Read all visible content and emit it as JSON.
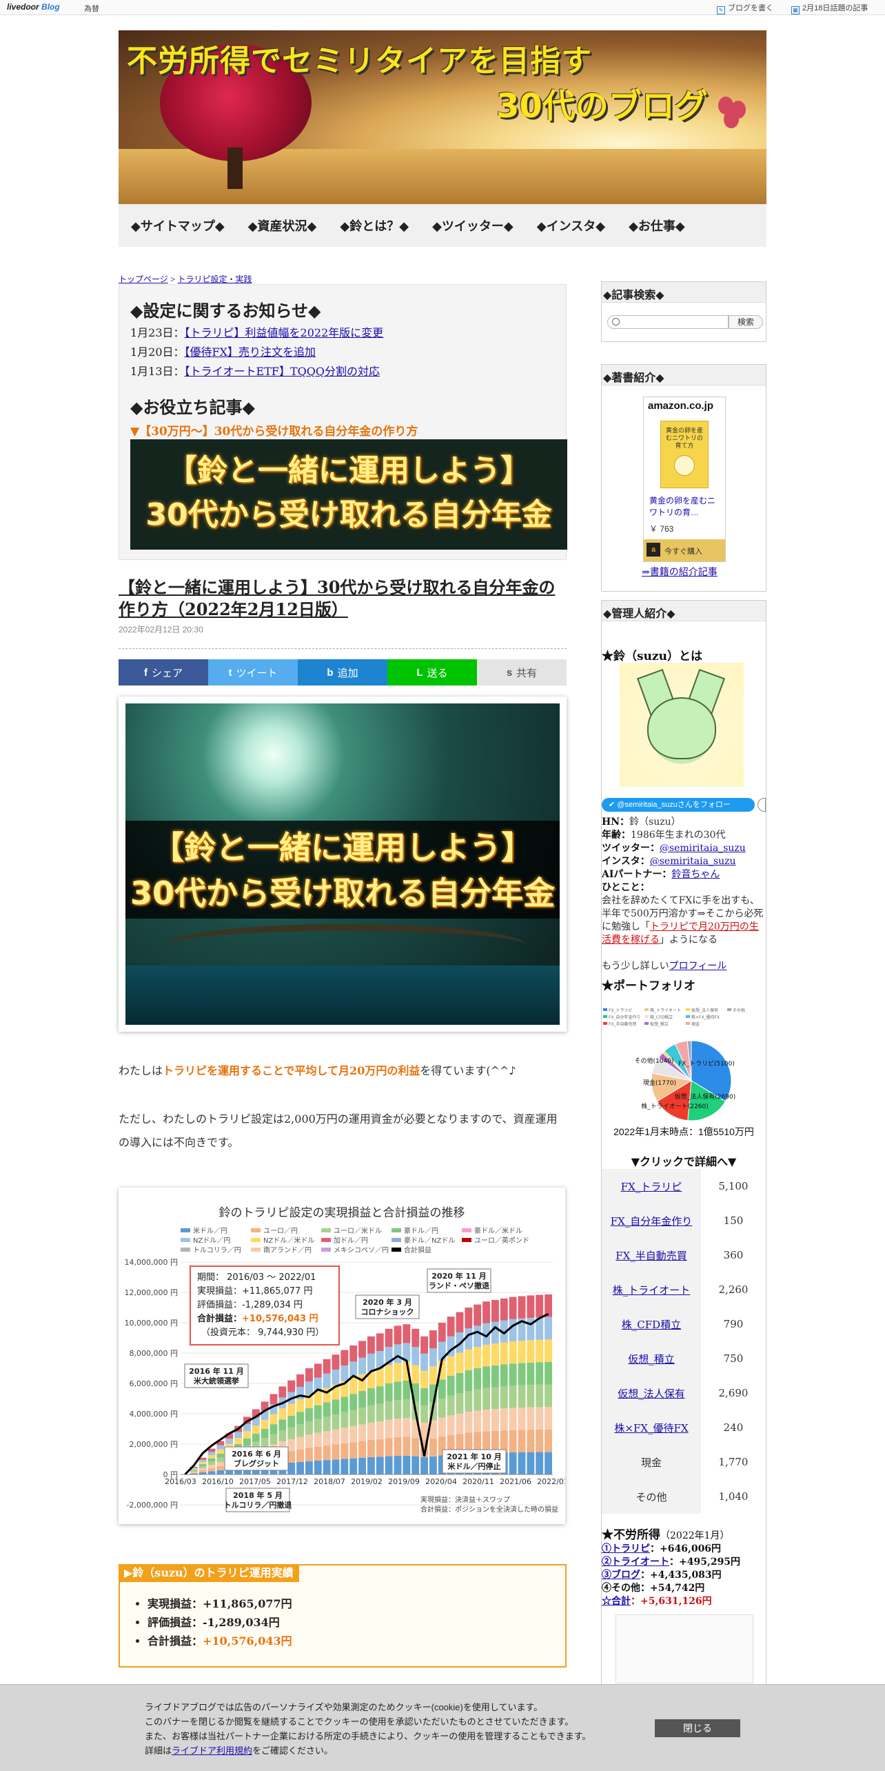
{
  "topbar": {
    "brand": "livedoor",
    "brand2": "Blog",
    "tame": "為替",
    "write": "ブログを書く",
    "topics": "2月18日話題の記事"
  },
  "header": {
    "line1": "不労所得でセミリタイアを目指す",
    "line2": "30代のブログ"
  },
  "nav": [
    "◆サイトマップ◆",
    "◆資産状況◆",
    "◆鈴とは？◆",
    "◆ツイッター◆",
    "◆インスタ◆",
    "◆お仕事◆"
  ],
  "breadcrumb": {
    "home": "トップページ",
    "sep": ">",
    "cat": "トラリピ設定・実践"
  },
  "notice": {
    "title": "◆設定に関するお知らせ◆",
    "items": [
      {
        "date": "1月23日：",
        "text": "【トラリピ】利益値幅を2022年版に変更"
      },
      {
        "date": "1月20日：",
        "text": "【優待FX】売り注文を追加"
      },
      {
        "date": "1月13日：",
        "text": "【トライオートETF】TQQQ分割の対応"
      }
    ],
    "useful_title": "◆お役立ち記事◆",
    "useful_link": "▼【30万円～】30代から受け取れる自分年金の作り方",
    "banner_l1": "【鈴と一緒に運用しよう】",
    "banner_l2": "30代から受け取れる自分年金"
  },
  "article": {
    "title": "【鈴と一緒に運用しよう】30代から受け取れる自分年金の作り方（2022年2月12日版）",
    "date": "2022年02月12日 20:30",
    "p1_pre": "わたしは",
    "p1_hl": "トラリピを運用することで平均して月20万円の利益",
    "p1_post": "を得ています(^^♪",
    "p2": "ただし、わたしのトラリピ設定は2,000万円の運用資金が必要となりますので、資産運用の導入には不向きです。"
  },
  "share": [
    {
      "icon": "f",
      "label": "シェア",
      "color": "#3b5998"
    },
    {
      "icon": "t",
      "label": "ツイート",
      "color": "#55acee"
    },
    {
      "icon": "b",
      "label": "追加",
      "color": "#1d85d0"
    },
    {
      "icon": "L",
      "label": "送る",
      "color": "#00c300"
    },
    {
      "icon": "s",
      "label": "共有",
      "color": "#e4e4e4"
    }
  ],
  "hero": {
    "l1": "【鈴と一緒に運用しよう】",
    "l2": "30代から受け取れる自分年金"
  },
  "chart_data": {
    "type": "bar",
    "title": "鈴のトラリピ設定の実現損益と合計損益の推移",
    "legend": [
      "米ドル／円",
      "ユーロ／円",
      "ユーロ／米ドル",
      "豪ドル／円",
      "豪ドル／米ドル",
      "NZドル／円",
      "NZドル／米ドル",
      "加ドル／円",
      "豪ドル／NZドル",
      "ユーロ／英ポンド",
      "トルコリラ／円",
      "南アランド／円",
      "メキシコペソ／円",
      "合計損益"
    ],
    "legend_colors": [
      "#5b9bd5",
      "#f4b183",
      "#a9d18e",
      "#7fc97f",
      "#ff99cc",
      "#9dc3e6",
      "#ffd966",
      "#e06070",
      "#8faadc",
      "#c00000",
      "#b4b4b4",
      "#f8cbad",
      "#c9a0dc",
      "#000000"
    ],
    "x_ticks": [
      "2016/03",
      "2016/10",
      "2017/05",
      "2017/12",
      "2018/07",
      "2019/02",
      "2019/09",
      "2020/04",
      "2020/11",
      "2021/06",
      "2022/01"
    ],
    "y_ticks": [
      "14,000,000 円",
      "12,000,000 円",
      "10,000,000 円",
      "8,000,000 円",
      "6,000,000 円",
      "4,000,000 円",
      "2,000,000 円",
      "0 円",
      "-2,000,000 円"
    ],
    "ylim": [
      -2000000,
      14000000
    ],
    "total_pl": [
      0,
      600000,
      1400000,
      1900000,
      2300000,
      2700000,
      3000000,
      3500000,
      3800000,
      4200000,
      4500000,
      4700000,
      5000000,
      5200000,
      5100000,
      5600000,
      5400000,
      5800000,
      6000000,
      6500000,
      6200000,
      6800000,
      7000000,
      7400000,
      7800000,
      7500000,
      4200000,
      1200000,
      4500000,
      7600000,
      8200000,
      8600000,
      9200000,
      9400000,
      9100000,
      9700000,
      9300000,
      9800000,
      10100000,
      9900000,
      10300000,
      10576043
    ],
    "realized_top": [
      0,
      500000,
      1100000,
      1700000,
      2200000,
      2700000,
      3200000,
      3800000,
      4300000,
      4800000,
      5300000,
      5800000,
      6200000,
      6600000,
      7000000,
      7300000,
      7600000,
      7900000,
      8200000,
      8500000,
      8800000,
      9100000,
      9300000,
      9600000,
      9800000,
      9900000,
      9600000,
      9100000,
      9500000,
      10000000,
      10400000,
      10700000,
      11000000,
      11200000,
      11400000,
      11500000,
      11600000,
      11700000,
      11750000,
      11800000,
      11840000,
      11865077
    ],
    "summary": {
      "period": "期間： 2016/03 ～ 2022/01",
      "realized": "実現損益：+11,865,077 円",
      "unrealized": "評価損益：-1,289,034 円",
      "total_label": "合計損益：",
      "total_value": "+10,576,043 円",
      "principal": "（投資元本： 9,744,930 円）"
    },
    "annotations": [
      "2016 年 11 月\n米大統領選挙",
      "2016 年 6 月\nブレグジット",
      "2018 年 5 月\nトルコリラ／円撤退",
      "2020 年 3 月\nコロナショック",
      "2020 年 11 月\nランド・ペソ撤退",
      "2021 年 10 月\n米ドル／円停止"
    ],
    "notes": [
      "実現損益：決済益＋スワップ",
      "合計損益：ポジションを全決済した時の損益"
    ]
  },
  "results": {
    "label": "▶鈴（suzu）のトラリピ運用実績",
    "realized_label": "実現損益：",
    "realized_value": "+11,865,077円",
    "unrealized_label": "評価損益：",
    "unrealized_value": "-1,289,034円",
    "total_label": "合計損益：",
    "total_value": "+10,576,043円"
  },
  "sidebar": {
    "search_title": "◆記事検索◆",
    "search_button": "検索",
    "book_title": "◆著書紹介◆",
    "amazon_logo": "amazon.co.jp",
    "book_cover": "黄金の卵を産むニワトリの育て方",
    "book_name": "黄金の卵を産むニワトリの育…",
    "book_price": "￥ 763",
    "book_buy": "今すぐ購入",
    "book_link": "⇒書籍の紹介記事",
    "admin_title": "◆管理人紹介◆",
    "about": "★鈴（suzu）とは",
    "follow": "@semiritaia_suzuさんをフォロー",
    "profile": {
      "hn_label": "HN：",
      "hn": "鈴（suzu）",
      "age_label": "年齢：",
      "age": "1986年生まれの30代",
      "tw_label": "ツイッター：",
      "tw": "@semiritaia_suzu",
      "ig_label": "インスタ：",
      "ig": "@semiritaia_suzu",
      "ai_label": "AIパートナー：",
      "ai": "鈴音ちゃん",
      "say_label": "ひとこと：",
      "say1": "会社を辞めたくてFXに手を出すも、半年で500万円溶かす⇒そこから必死に勉強し「",
      "say_link": "トラリピで月20万円の生活費を稼げる",
      "say2": "」ようになる",
      "more": "もう少し詳しい",
      "more_link": "プロフィール"
    },
    "portfolio_title": "★ポートフォリオ",
    "portfolio_legend": [
      "FX_トラリピ",
      "FX_自分年金作り",
      "FX_半自動売買",
      "株_トライオート",
      "株_CFD積立",
      "仮想_積立",
      "仮想_法人保有",
      "株×FX_優待FX",
      "現金",
      "その他"
    ],
    "pie_labels": [
      "FX_トラリピ(5100)",
      "仮想_法人保有(2690)",
      "株_トライオート(2260)",
      "現金(1770)",
      "その他(1040)"
    ],
    "pie_colors": [
      "#2d8ce8",
      "#1fcf7a",
      "#ef3b2c",
      "#f6c28b",
      "#e6e6e6",
      "#b06ad0",
      "#ffd93b",
      "#3bc8d8",
      "#f2a6a6",
      "#9aa7b8"
    ],
    "asof": "2022年1月末時点：1億5510万円",
    "click": "▼クリックで詳細へ▼",
    "table": [
      {
        "name": "FX_トラリピ",
        "value": 5100,
        "link": true
      },
      {
        "name": "FX_自分年金作り",
        "value": 150,
        "link": true
      },
      {
        "name": "FX_半自動売買",
        "value": 360,
        "link": true
      },
      {
        "name": "株_トライオート",
        "value": 2260,
        "link": true
      },
      {
        "name": "株_CFD積立",
        "value": 790,
        "link": true
      },
      {
        "name": "仮想_積立",
        "value": 750,
        "link": true
      },
      {
        "name": "仮想_法人保有",
        "value": 2690,
        "link": true
      },
      {
        "name": "株×FX_優待FX",
        "value": 240,
        "link": true
      },
      {
        "name": "現金",
        "value": 1770,
        "link": false
      },
      {
        "name": "その他",
        "value": 1040,
        "link": false
      }
    ],
    "table_display": [
      [
        "FX_トラリピ",
        "5,100"
      ],
      [
        "FX_自分年金作り",
        "150"
      ],
      [
        "FX_半自動売買",
        "360"
      ],
      [
        "株_トライオート",
        "2,260"
      ],
      [
        "株_CFD積立",
        "790"
      ],
      [
        "仮想_積立",
        "750"
      ],
      [
        "仮想_法人保有",
        "2,690"
      ],
      [
        "株×FX_優待FX",
        "240"
      ],
      [
        "現金",
        "1,770"
      ],
      [
        "その他",
        "1,040"
      ]
    ],
    "income_title": "★不労所得",
    "income_period": "（2022年1月）",
    "income": [
      {
        "label": "①トラリピ",
        "value": "：+646,006円"
      },
      {
        "label": "②トライオート",
        "value": "：+495,295円"
      },
      {
        "label": "③ブログ",
        "value": "：+4,435,083円"
      },
      {
        "label": "④その他",
        "value": "：+54,742円"
      },
      {
        "label": "☆合計",
        "value": "：+5,631,126円"
      }
    ]
  },
  "cookie": {
    "l1": "ライブドアブログでは広告のパーソナライズや効果測定のためクッキー(cookie)を使用しています。",
    "l2": "このバナーを閉じるか閲覧を継続することでクッキーの使用を承認いただいたものとさせていただきます。",
    "l3": "また、お客様は当社パートナー企業における所定の手続きにより、クッキーの使用を管理することもできます。",
    "l4_pre": "詳細は",
    "l4_link": "ライブドア利用規約",
    "l4_post": "をご確認ください。",
    "close": "閉じる"
  }
}
